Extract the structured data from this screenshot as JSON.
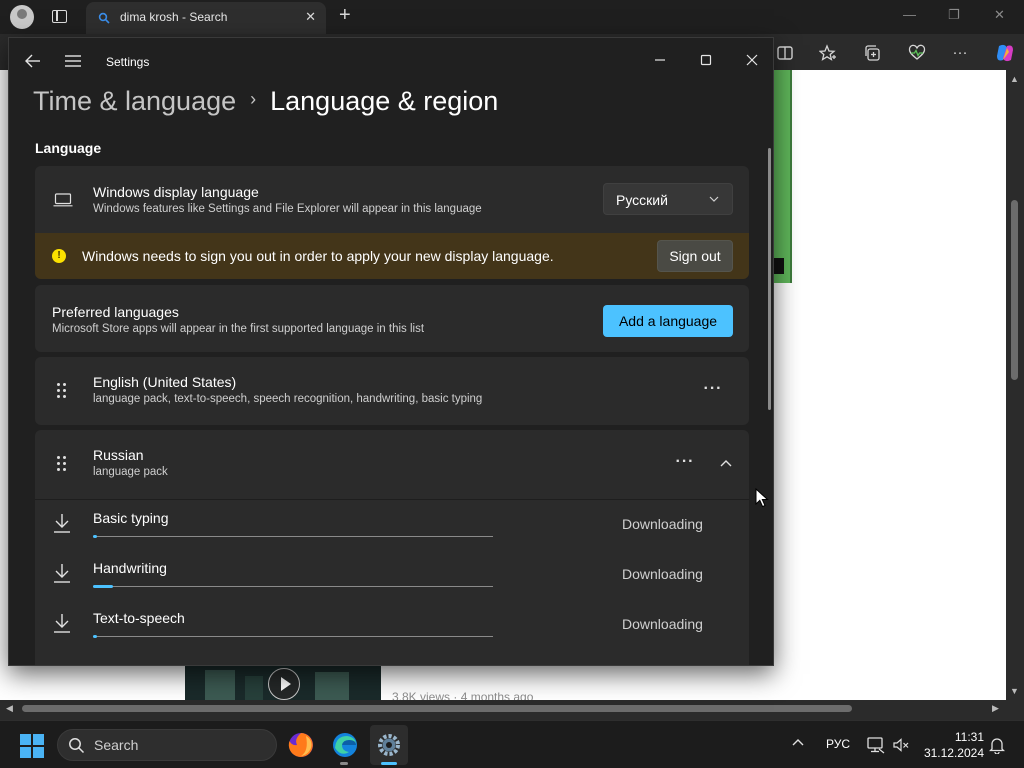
{
  "browser": {
    "tab_title": "dima krosh - Search",
    "views_text": "3.8K views · 4 months ago"
  },
  "settings": {
    "app_title": "Settings",
    "breadcrumb": {
      "parent": "Time & language",
      "current": "Language & region"
    },
    "section_label": "Language",
    "display_language": {
      "title": "Windows display language",
      "subtitle": "Windows features like Settings and File Explorer will appear in this language",
      "selected": "Русский"
    },
    "signout_banner": {
      "text": "Windows needs to sign you out in order to apply your new display language.",
      "button": "Sign out"
    },
    "preferred": {
      "title": "Preferred languages",
      "subtitle": "Microsoft Store apps will appear in the first supported language in this list",
      "add_button": "Add a language"
    },
    "languages": [
      {
        "name": "English (United States)",
        "features": "language pack, text-to-speech, speech recognition, handwriting, basic typing"
      },
      {
        "name": "Russian",
        "features": "language pack"
      }
    ],
    "downloads": [
      {
        "label": "Basic typing",
        "status": "Downloading",
        "progress": 0.01
      },
      {
        "label": "Handwriting",
        "status": "Downloading",
        "progress": 0.05
      },
      {
        "label": "Text-to-speech",
        "status": "Downloading",
        "progress": 0.01
      }
    ]
  },
  "taskbar": {
    "search_placeholder": "Search",
    "input_language": "РУС",
    "time": "11:31",
    "date": "31.12.2024"
  },
  "colors": {
    "accent": "#4cc2ff",
    "warning_bg": "#433519",
    "warning_icon": "#fce100"
  }
}
